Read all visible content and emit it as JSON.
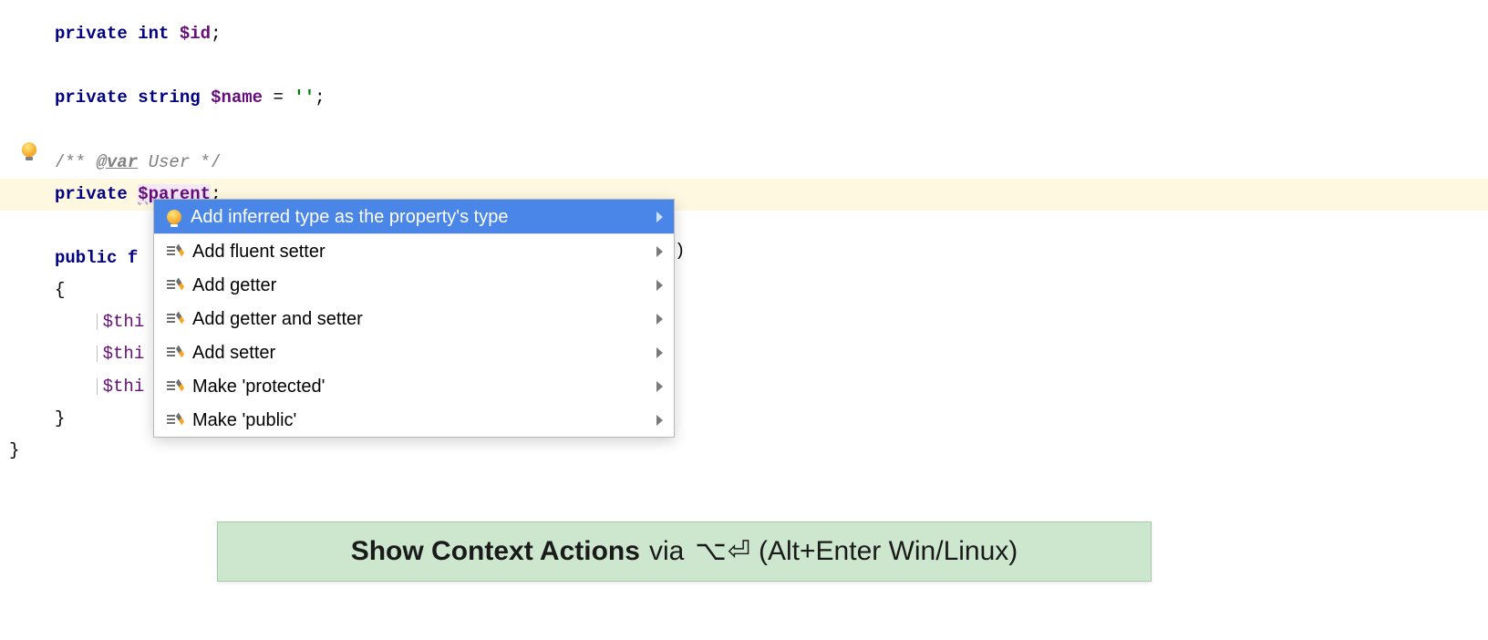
{
  "code": {
    "line1": {
      "kw": "private",
      "type": "int",
      "var": "$id",
      "semi": ";"
    },
    "line3": {
      "kw": "private",
      "type": "string",
      "var": "$name",
      "eq": " = ",
      "str": "''",
      "semi": ";"
    },
    "doc": {
      "open": "/** ",
      "tag": "@var",
      "cls": " User ",
      "close": "*/"
    },
    "line5": {
      "kw": "private",
      "var": "$parent",
      "semi": ";"
    },
    "line7": {
      "kw": "public",
      "fn": "f"
    },
    "brace_open": "{",
    "this1": "$thi",
    "this2": "$thi",
    "this3": "$thi",
    "brace_close": "}",
    "outer_close": "}",
    "behind_paren": ")"
  },
  "popup": {
    "items": [
      {
        "icon": "bulb",
        "label": "Add inferred type as the property's type",
        "selected": true
      },
      {
        "icon": "pen",
        "label": "Add fluent setter",
        "selected": false
      },
      {
        "icon": "pen",
        "label": "Add getter",
        "selected": false
      },
      {
        "icon": "pen",
        "label": "Add getter and setter",
        "selected": false
      },
      {
        "icon": "pen",
        "label": "Add setter",
        "selected": false
      },
      {
        "icon": "pen",
        "label": "Make 'protected'",
        "selected": false
      },
      {
        "icon": "pen",
        "label": "Make 'public'",
        "selected": false
      }
    ]
  },
  "hint": {
    "title": "Show Context Actions",
    "via": "via",
    "keys": "⌥⏎",
    "alt": "(Alt+Enter Win/Linux)"
  }
}
